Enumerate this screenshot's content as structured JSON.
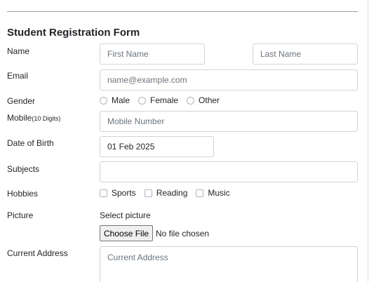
{
  "form": {
    "title": "Student Registration Form",
    "labels": {
      "name": "Name",
      "email": "Email",
      "gender": "Gender",
      "mobile": "Mobile",
      "mobile_hint": "(10 Digits)",
      "dob": "Date of Birth",
      "subjects": "Subjects",
      "hobbies": "Hobbies",
      "picture": "Picture",
      "address": "Current Address"
    },
    "fields": {
      "first_name_placeholder": "First Name",
      "last_name_placeholder": "Last Name",
      "email_placeholder": "name@example.com",
      "mobile_placeholder": "Mobile Number",
      "dob_value": "01 Feb 2025",
      "subjects_value": "",
      "address_placeholder": "Current Address"
    },
    "gender_options": [
      "Male",
      "Female",
      "Other"
    ],
    "hobby_options": [
      "Sports",
      "Reading",
      "Music"
    ],
    "picture": {
      "prompt": "Select picture",
      "button_label": "Choose File",
      "status": "No file chosen"
    }
  }
}
